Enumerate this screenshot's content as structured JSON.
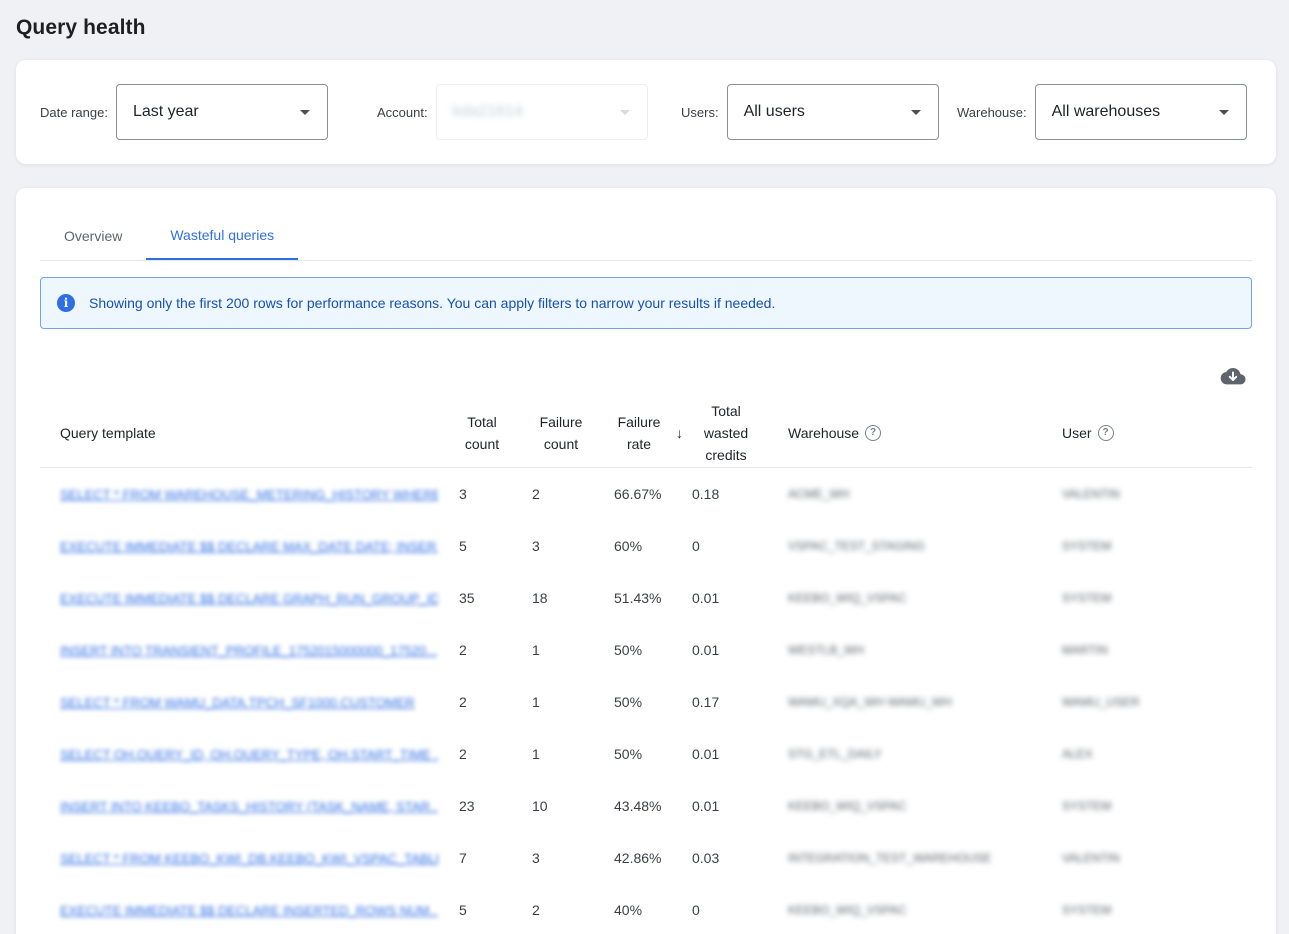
{
  "page": {
    "title": "Query health"
  },
  "filters": {
    "date_range": {
      "label": "Date range:",
      "value": "Last year"
    },
    "account": {
      "label": "Account:",
      "value": "kda21614"
    },
    "users": {
      "label": "Users:",
      "value": "All users"
    },
    "warehouse": {
      "label": "Warehouse:",
      "value": "All warehouses"
    }
  },
  "tabs": [
    {
      "label": "Overview",
      "active": false
    },
    {
      "label": "Wasteful queries",
      "active": true
    }
  ],
  "banner": {
    "text": "Showing only the first 200 rows for performance reasons. You can apply filters to narrow your results if needed.",
    "icon": "info-icon"
  },
  "table": {
    "headers": {
      "query_template": "Query template",
      "total_count": "Total count",
      "failure_count": "Failure count",
      "failure_rate": "Failure rate",
      "total_wasted_credits": "Total wasted credits",
      "warehouse": "Warehouse",
      "user": "User"
    },
    "rows": [
      {
        "query": "SELECT * FROM WAREHOUSE_METERING_HISTORY WHERE ...",
        "total": "3",
        "failures": "2",
        "rate": "66.67%",
        "credits": "0.18",
        "warehouse": "ACME_WH",
        "user": "VALENTIN"
      },
      {
        "query": "EXECUTE IMMEDIATE $$ DECLARE MAX_DATE DATE; INSER...",
        "total": "5",
        "failures": "3",
        "rate": "60%",
        "credits": "0",
        "warehouse": "VSPAC_TEST_STAGING",
        "user": "SYSTEM"
      },
      {
        "query": "EXECUTE IMMEDIATE $$ DECLARE GRAPH_RUN_GROUP_ID ...",
        "total": "35",
        "failures": "18",
        "rate": "51.43%",
        "credits": "0.01",
        "warehouse": "KEEBO_WIQ_VSPAC",
        "user": "SYSTEM"
      },
      {
        "query": "INSERT INTO TRANSIENT_PROFILE_1752015000000_17520...",
        "total": "2",
        "failures": "1",
        "rate": "50%",
        "credits": "0.01",
        "warehouse": "WESTLB_WH",
        "user": "MARTIN"
      },
      {
        "query": "SELECT * FROM WAMU_DATA.TPCH_SF1000.CUSTOMER",
        "total": "2",
        "failures": "1",
        "rate": "50%",
        "credits": "0.17",
        "warehouse": "WAMU_XQA_WH WAMU_WH",
        "user": "WAMU_USER"
      },
      {
        "query": "SELECT QH.QUERY_ID, QH.QUERY_TYPE, QH.START_TIME ...",
        "total": "2",
        "failures": "1",
        "rate": "50%",
        "credits": "0.01",
        "warehouse": "STG_ETL_DAILY",
        "user": "ALEX"
      },
      {
        "query": "INSERT INTO KEEBO_TASKS_HISTORY (TASK_NAME, STAR...",
        "total": "23",
        "failures": "10",
        "rate": "43.48%",
        "credits": "0.01",
        "warehouse": "KEEBO_WIQ_VSPAC",
        "user": "SYSTEM"
      },
      {
        "query": "SELECT * FROM KEEBO_KWI_DB.KEEBO_KWI_VSPAC_TABLE ...",
        "total": "7",
        "failures": "3",
        "rate": "42.86%",
        "credits": "0.03",
        "warehouse": "INTEGRATION_TEST_WAREHOUSE",
        "user": "VALENTIN"
      },
      {
        "query": "EXECUTE IMMEDIATE $$ DECLARE INSERTED_ROWS NUM...",
        "total": "5",
        "failures": "2",
        "rate": "40%",
        "credits": "0",
        "warehouse": "KEEBO_WIQ_VSPAC",
        "user": "SYSTEM"
      }
    ]
  },
  "colors": {
    "accent": "#2f6fe4",
    "banner_bg": "#eef6fe",
    "banner_border": "#6fa6ea",
    "page_bg": "#f0f1f4"
  }
}
